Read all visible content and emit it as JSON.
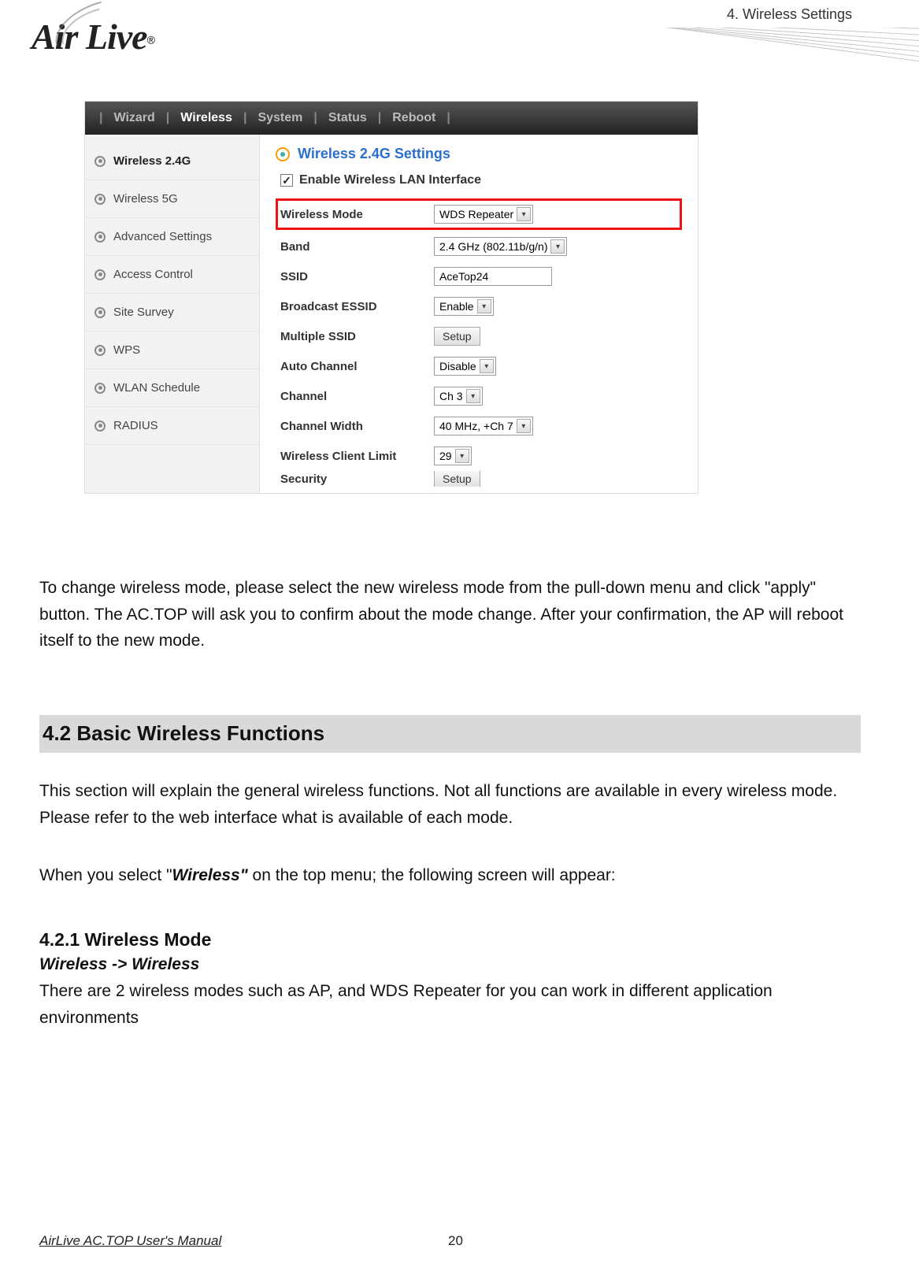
{
  "header": {
    "chapter": "4. Wireless Settings"
  },
  "logo": {
    "text": "Air Live",
    "reg": "®"
  },
  "screenshot": {
    "nav": {
      "items": [
        "Wizard",
        "Wireless",
        "System",
        "Status",
        "Reboot"
      ],
      "active_index": 1
    },
    "sidebar": [
      "Wireless 2.4G",
      "Wireless 5G",
      "Advanced Settings",
      "Access Control",
      "Site Survey",
      "WPS",
      "WLAN Schedule",
      "RADIUS"
    ],
    "main": {
      "title": "Wireless 2.4G Settings",
      "enable_label": "Enable Wireless LAN Interface",
      "rows": [
        {
          "label": "Wireless Mode",
          "type": "select",
          "value": "WDS Repeater",
          "highlight": true
        },
        {
          "label": "Band",
          "type": "select",
          "value": "2.4 GHz (802.11b/g/n)"
        },
        {
          "label": "SSID",
          "type": "input",
          "value": "AceTop24"
        },
        {
          "label": "Broadcast ESSID",
          "type": "select",
          "value": "Enable"
        },
        {
          "label": "Multiple SSID",
          "type": "button",
          "value": "Setup"
        },
        {
          "label": "Auto Channel",
          "type": "select",
          "value": "Disable"
        },
        {
          "label": "Channel",
          "type": "select",
          "value": "Ch 3"
        },
        {
          "label": "Channel Width",
          "type": "select",
          "value": "40 MHz, +Ch 7"
        },
        {
          "label": "Wireless Client Limit",
          "type": "select",
          "value": "29"
        },
        {
          "label": "Security",
          "type": "button",
          "value": "Setup",
          "cut": true
        }
      ]
    }
  },
  "para1": "To change wireless mode, please select the new wireless mode from the pull-down menu and click \"apply\" button.   The AC.TOP will ask you to confirm about the mode change.   After your confirmation, the AP will reboot itself to the new mode.",
  "section_heading": "4.2 Basic Wireless Functions",
  "para2": "This section will explain the general wireless functions.   Not all functions are available in every wireless mode.   Please refer to the web interface what is available of each mode.",
  "para3_pre": "When you select \"",
  "para3_bold": "Wireless\"",
  "para3_post": " on the top menu; the following screen will appear:",
  "subsection_heading": "4.2.1 Wireless Mode",
  "breadcrumb": "Wireless -> Wireless",
  "para4": "There are 2 wireless modes such as AP, and WDS Repeater for you can work in different application environments",
  "footer": {
    "manual": "AirLive AC.TOP User's Manual",
    "page": "20"
  }
}
